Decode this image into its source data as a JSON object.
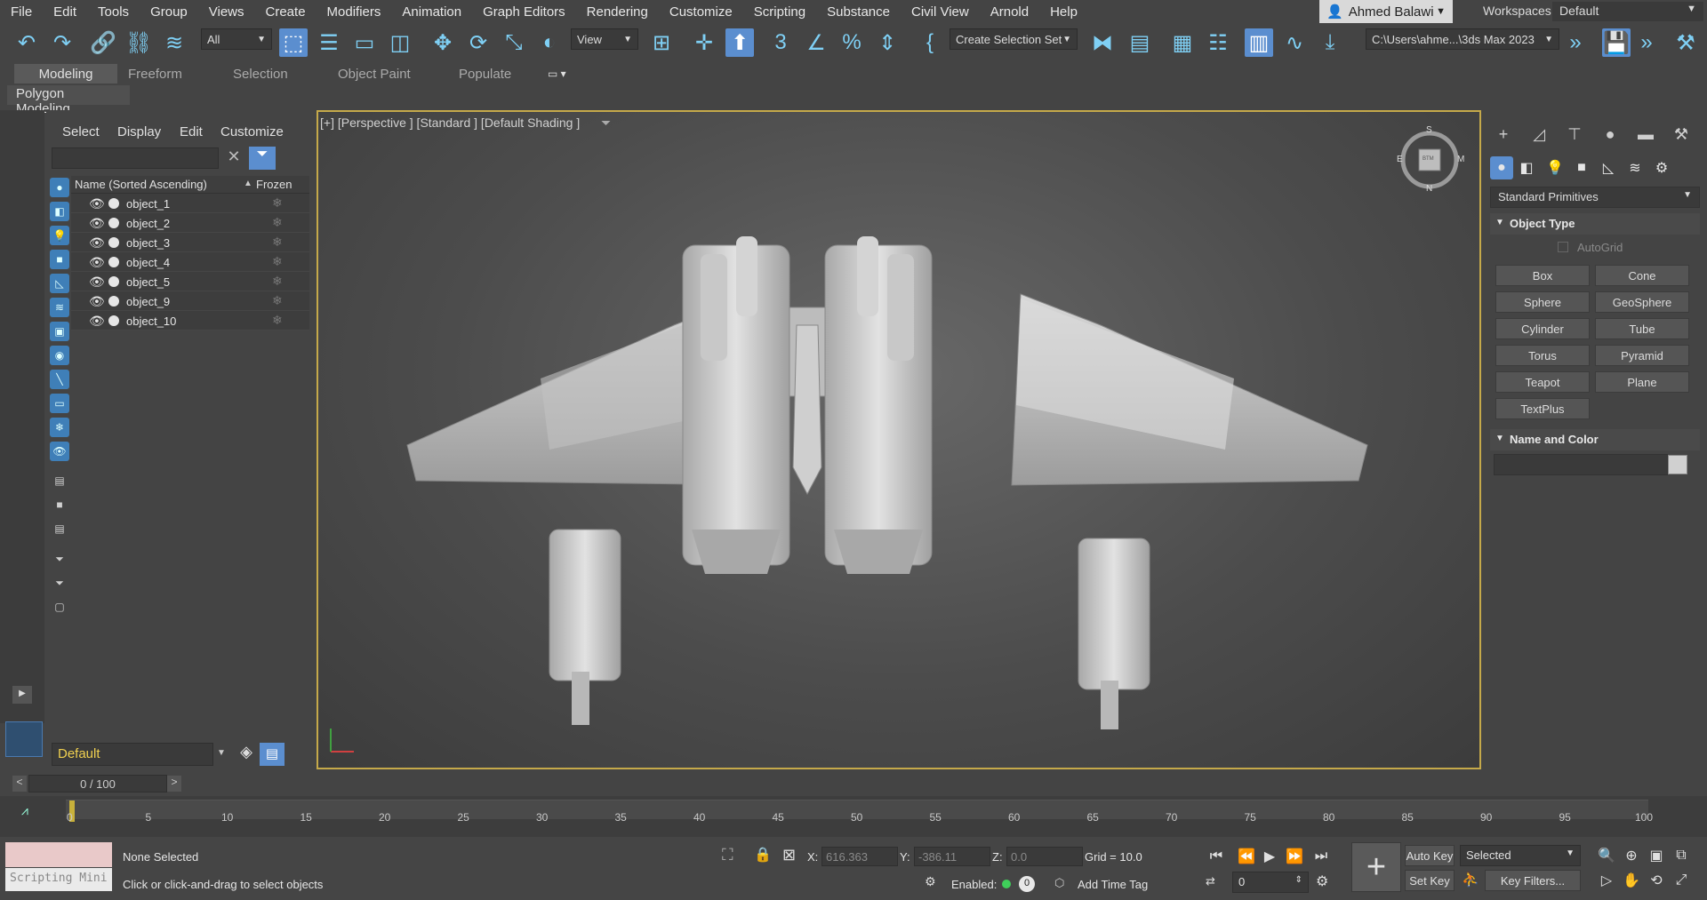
{
  "menu": [
    "File",
    "Edit",
    "Tools",
    "Group",
    "Views",
    "Create",
    "Modifiers",
    "Animation",
    "Graph Editors",
    "Rendering",
    "Customize",
    "Scripting",
    "Substance",
    "Civil View",
    "Arnold",
    "Help"
  ],
  "user": "Ahmed Balawi",
  "workspace": {
    "label": "Workspaces:",
    "value": "Default"
  },
  "toolbar": {
    "selection_filter": "All",
    "ref_coord": "View",
    "selection_set": "Create Selection Set",
    "project_path": "C:\\Users\\ahme...\\3ds Max 2023"
  },
  "ribbon": {
    "tabs": [
      "Modeling",
      "Freeform",
      "Selection",
      "Object Paint",
      "Populate"
    ],
    "active": "Modeling",
    "panel": "Polygon Modeling"
  },
  "explorer": {
    "menus": [
      "Select",
      "Display",
      "Edit",
      "Customize"
    ],
    "search_value": "",
    "col_name": "Name (Sorted Ascending)",
    "sort_glyph": "▲",
    "col_frozen": "Frozen",
    "objects": [
      "object_1",
      "object_2",
      "object_3",
      "object_4",
      "object_5",
      "object_9",
      "object_10"
    ],
    "layer": "Default"
  },
  "viewport": {
    "label": "[+] [Perspective ] [Standard ] [Default Shading ]",
    "cube_top": "S",
    "cube_bottom": "N",
    "cube_left": "E",
    "cube_right": "M",
    "cube_face": "BTM"
  },
  "command_panel": {
    "category": "Standard Primitives",
    "object_type_title": "Object Type",
    "autogrid": "AutoGrid",
    "buttons": [
      "Box",
      "Cone",
      "Sphere",
      "GeoSphere",
      "Cylinder",
      "Tube",
      "Torus",
      "Pyramid",
      "Teapot",
      "Plane",
      "TextPlus"
    ],
    "name_color_title": "Name and Color",
    "swatch_color": "#d0d0d0"
  },
  "timeline": {
    "slider": "0 / 100",
    "ticks": [
      "0",
      "5",
      "10",
      "15",
      "20",
      "25",
      "30",
      "35",
      "40",
      "45",
      "50",
      "55",
      "60",
      "65",
      "70",
      "75",
      "80",
      "85",
      "90",
      "95",
      "100"
    ]
  },
  "status": {
    "script_label": "Scripting Mini",
    "selection": "None Selected",
    "prompt": "Click or click-and-drag to select objects",
    "x_label": "X:",
    "x": "616.363",
    "y_label": "Y:",
    "y": "-386.11",
    "z_label": "Z:",
    "z": "0.0",
    "grid": "Grid = 10.0",
    "enabled_label": "Enabled:",
    "enabled_value": "0",
    "add_time_tag": "Add Time Tag",
    "auto_key": "Auto Key",
    "set_key": "Set Key",
    "key_mode": "Selected",
    "key_filters": "Key Filters...",
    "frame": "0"
  },
  "colors": {
    "accent": "#5b8ecf",
    "viewport_border": "#c5a94a",
    "icon": "#7fd0f5"
  }
}
